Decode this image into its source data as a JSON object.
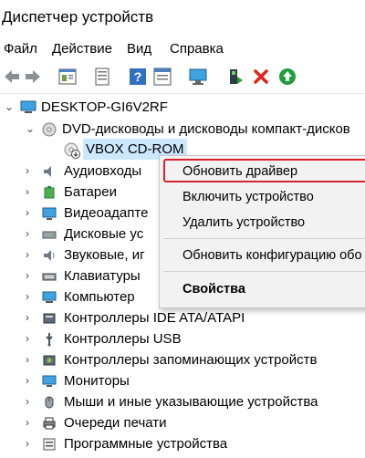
{
  "window": {
    "title": "Диспетчер устройств"
  },
  "menu": [
    "Файл",
    "Действие",
    "Вид",
    "Справка"
  ],
  "toolbar": [
    "back-icon",
    "forward-icon",
    "properties-icon",
    "help-icon",
    "driver-icon",
    "scan-icon",
    "enable-icon",
    "delete-icon",
    "update-icon"
  ],
  "tree": {
    "root": "DESKTOP-GI6V2RF",
    "dvd_group": "DVD-дисководы и дисководы компакт-дисков",
    "dvd_device": "VBOX CD-ROM",
    "categories": [
      "Аудиовходы",
      "Батареи",
      "Видеоадапте",
      "Дисковые ус",
      "Звуковые, иг",
      "Клавиатуры",
      "Компьютер",
      "Контроллеры IDE ATA/ATAPI",
      "Контроллеры USB",
      "Контроллеры запоминающих устройств",
      "Мониторы",
      "Мыши и иные указывающие устройства",
      "Очереди печати",
      "Программные устройства"
    ]
  },
  "context_menu": {
    "items": [
      "Обновить драйвер",
      "Включить устройство",
      "Удалить устройство",
      "Обновить конфигурацию обо",
      "Свойства"
    ],
    "highlight_color": "#d6232d"
  }
}
